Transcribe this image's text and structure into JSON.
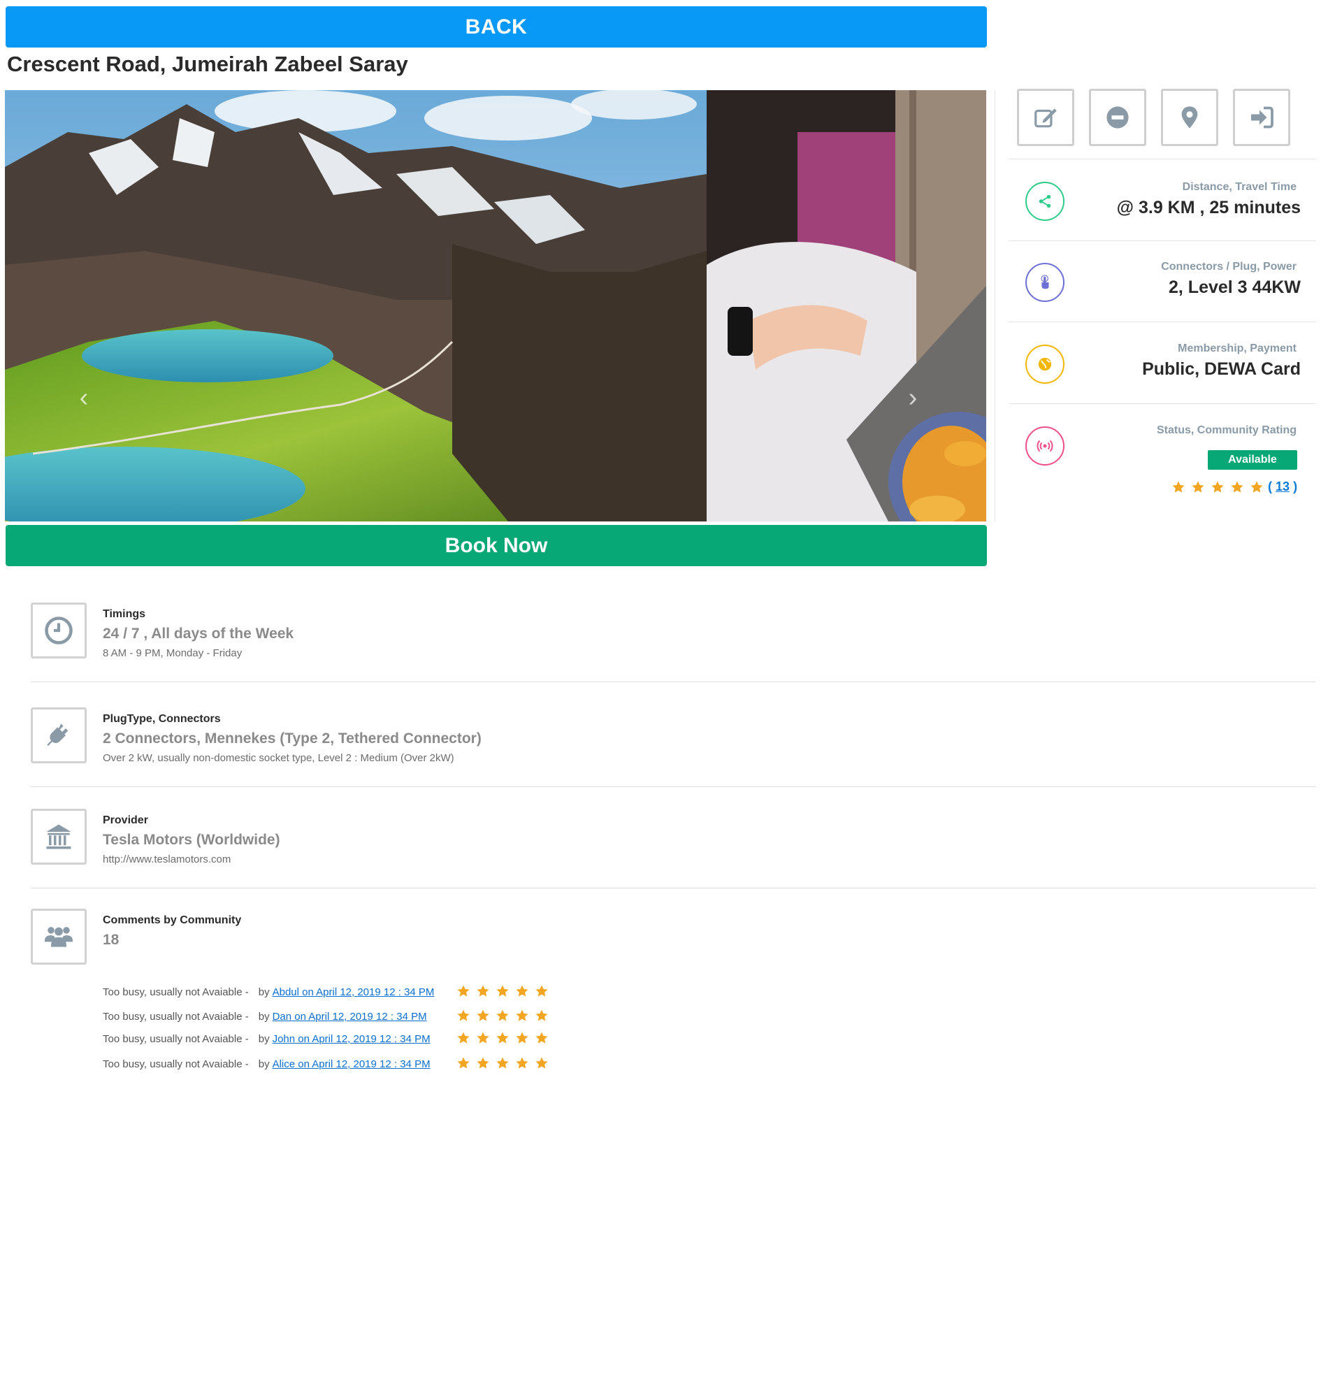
{
  "nav": {
    "back_label": "BACK"
  },
  "station": {
    "title": "Crescent Road, Jumeirah Zabeel Saray"
  },
  "carousel": {
    "prev_glyph": "‹",
    "next_glyph": "›"
  },
  "booking": {
    "book_label": "Book Now"
  },
  "actions": [
    {
      "icon": "edit-icon"
    },
    {
      "icon": "minus-circle-icon"
    },
    {
      "icon": "map-marker-icon"
    },
    {
      "icon": "sign-in-icon"
    }
  ],
  "info": {
    "distance": {
      "label": "Distance, Travel Time",
      "value": "@ 3.9 KM , 25 minutes",
      "color": "#2ecc8a",
      "icon": "share-icon"
    },
    "connectors": {
      "label": "Connectors / Plug, Power",
      "value": "2, Level 3 44KW",
      "color": "#6b6fd6",
      "icon": "hand-pointer-icon"
    },
    "membership": {
      "label": "Membership, Payment",
      "value": "Public, DEWA Card",
      "color": "#f2b705",
      "icon": "globe-icon"
    },
    "status": {
      "label": "Status, Community Rating",
      "badge": "Available",
      "color": "#f0508a",
      "icon": "broadcast-icon",
      "rating_stars": 5,
      "rating_count_open": "(",
      "rating_count": "13",
      "rating_count_close": ")"
    }
  },
  "details": {
    "timings": {
      "heading": "Timings",
      "main": "24 / 7 , All days of the Week",
      "sub": "8 AM - 9 PM, Monday - Friday",
      "icon": "clock-icon"
    },
    "plug": {
      "heading": "PlugType, Connectors",
      "main": "2 Connectors, Mennekes (Type 2, Tethered Connector)",
      "sub": "Over 2 kW, usually non-domestic socket type, Level 2 : Medium (Over 2kW)",
      "icon": "plug-icon"
    },
    "provider": {
      "heading": "Provider",
      "main": "Tesla Motors (Worldwide)",
      "sub": "http://www.teslamotors.com",
      "icon": "bank-icon"
    },
    "comments": {
      "heading": "Comments by Community",
      "main": "18",
      "icon": "users-icon"
    }
  },
  "comments": [
    {
      "text": "Too busy, usually not Avaiable -",
      "by": "by",
      "author": "Abdul on April 12, 2019 12 : 34 PM",
      "stars": 5
    },
    {
      "text": "Too busy, usually not Avaiable -",
      "by": "by",
      "author": "Dan on April 12, 2019 12 : 34 PM",
      "stars": 5
    },
    {
      "text": "Too busy, usually not Avaiable -",
      "by": "by",
      "author": "John on April 12, 2019 12 : 34 PM",
      "stars": 5
    },
    {
      "text": "Too busy, usually not Avaiable -",
      "by": "by",
      "author": "Alice on April 12, 2019 12 : 34 PM",
      "stars": 5
    }
  ],
  "colors": {
    "primary": "#0899f7",
    "success": "#08a776",
    "star": "#f4a623",
    "link": "#0a6fd0"
  }
}
